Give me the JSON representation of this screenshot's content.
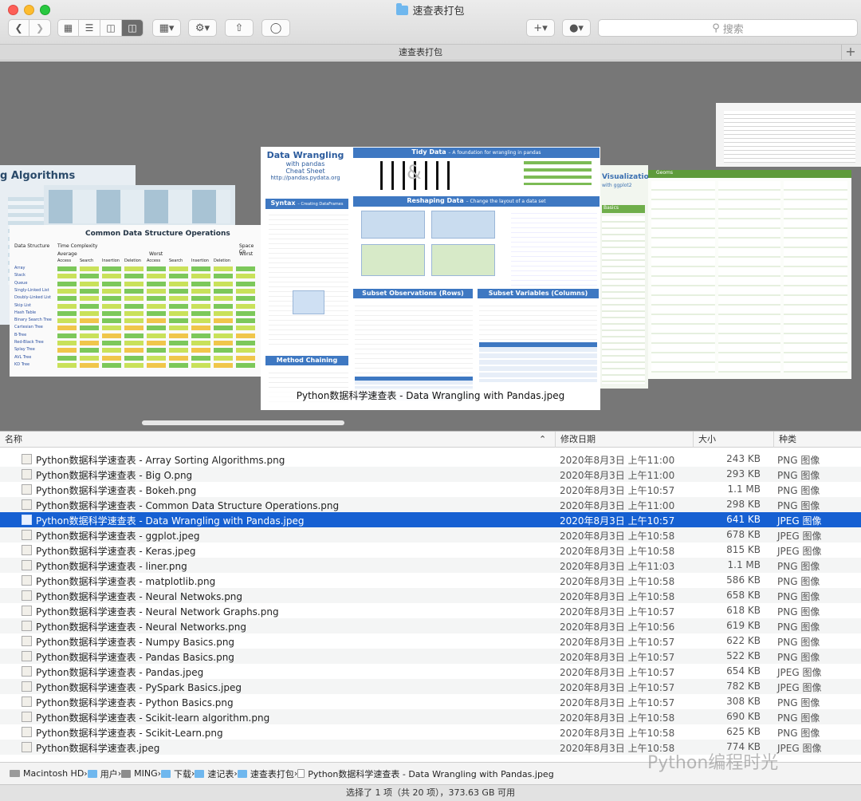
{
  "window": {
    "title": "速查表打包"
  },
  "toolbar": {
    "back_icon": "chevron-left-icon",
    "forward_icon": "chevron-right-icon",
    "search_placeholder": "搜索",
    "add_label": "+"
  },
  "tab": {
    "label": "速查表打包",
    "add_label": "+"
  },
  "coverflow": {
    "caption": "Python数据科学速查表 - Data Wrangling with Pandas.jpeg",
    "covers": {
      "left1_title": "g Algorithms",
      "left2_title": "Common Data Structure Operations",
      "left2_sub1": "Time Complexity",
      "left2_sub2": "Space Co",
      "left2_avg": "Average",
      "left2_worst": "Worst",
      "left2_worst2": "Worst",
      "left2_ds": "Data Structure",
      "left2_cols": [
        "Access",
        "Search",
        "Insertion",
        "Deletion",
        "Access",
        "Search",
        "Insertion",
        "Deletion"
      ],
      "left2_rows": [
        "Array",
        "Stack",
        "Queue",
        "Singly-Linked List",
        "Doubly-Linked List",
        "Skip List",
        "Hash Table",
        "Binary Search Tree",
        "Cartesian Tree",
        "B-Tree",
        "Red-Black Tree",
        "Splay Tree",
        "AVL Tree",
        "KD Tree"
      ],
      "main_t1": "Data Wrangling",
      "main_t2": "with pandas",
      "main_t3": "Cheat Sheet",
      "main_t4": "http://pandas.pydata.org",
      "main_tidy": "Tidy Data",
      "main_tidy_sub": "– A foundation for wrangling in pandas",
      "main_syntax": "Syntax",
      "main_syntax_sub": "– Creating DataFrames",
      "main_reshape": "Reshaping Data",
      "main_reshape_sub": "– Change the layout of a data set",
      "main_subset_obs": "Subset Observations (Rows)",
      "main_subset_vars": "Subset Variables (Columns)",
      "main_method": "Method Chaining",
      "right1_title": "Visualization",
      "right1_sub": "with ggplot2",
      "right1_basics": "Basics",
      "right1_geoms": "Geoms"
    }
  },
  "columns": {
    "name": "名称",
    "date": "修改日期",
    "size": "大小",
    "kind": "种类"
  },
  "files": [
    {
      "name": "Python数据科学速查表 - Array Sorting Algorithms.png",
      "date": "2020年8月3日 上午11:00",
      "size": "243 KB",
      "kind": "PNG 图像"
    },
    {
      "name": "Python数据科学速查表 - Big O.png",
      "date": "2020年8月3日 上午11:00",
      "size": "293 KB",
      "kind": "PNG 图像"
    },
    {
      "name": "Python数据科学速查表 - Bokeh.png",
      "date": "2020年8月3日 上午10:57",
      "size": "1.1 MB",
      "kind": "PNG 图像"
    },
    {
      "name": "Python数据科学速查表 - Common Data Structure Operations.png",
      "date": "2020年8月3日 上午11:00",
      "size": "298 KB",
      "kind": "PNG 图像"
    },
    {
      "name": "Python数据科学速查表 - Data Wrangling with Pandas.jpeg",
      "date": "2020年8月3日 上午10:57",
      "size": "641 KB",
      "kind": "JPEG 图像"
    },
    {
      "name": "Python数据科学速查表 - ggplot.jpeg",
      "date": "2020年8月3日 上午10:58",
      "size": "678 KB",
      "kind": "JPEG 图像"
    },
    {
      "name": "Python数据科学速查表 - Keras.jpeg",
      "date": "2020年8月3日 上午10:58",
      "size": "815 KB",
      "kind": "JPEG 图像"
    },
    {
      "name": "Python数据科学速查表 - liner.png",
      "date": "2020年8月3日 上午11:03",
      "size": "1.1 MB",
      "kind": "PNG 图像"
    },
    {
      "name": "Python数据科学速查表 - matplotlib.png",
      "date": "2020年8月3日 上午10:58",
      "size": "586 KB",
      "kind": "PNG 图像"
    },
    {
      "name": "Python数据科学速查表 - Neural Netwoks.png",
      "date": "2020年8月3日 上午10:58",
      "size": "658 KB",
      "kind": "PNG 图像"
    },
    {
      "name": "Python数据科学速查表 - Neural Network Graphs.png",
      "date": "2020年8月3日 上午10:57",
      "size": "618 KB",
      "kind": "PNG 图像"
    },
    {
      "name": "Python数据科学速查表 - Neural Networks.png",
      "date": "2020年8月3日 上午10:56",
      "size": "619 KB",
      "kind": "PNG 图像"
    },
    {
      "name": "Python数据科学速查表 - Numpy Basics.png",
      "date": "2020年8月3日 上午10:57",
      "size": "622 KB",
      "kind": "PNG 图像"
    },
    {
      "name": "Python数据科学速查表 - Pandas Basics.png",
      "date": "2020年8月3日 上午10:57",
      "size": "522 KB",
      "kind": "PNG 图像"
    },
    {
      "name": "Python数据科学速查表 - Pandas.jpeg",
      "date": "2020年8月3日 上午10:57",
      "size": "654 KB",
      "kind": "JPEG 图像"
    },
    {
      "name": "Python数据科学速查表 - PySpark Basics.jpeg",
      "date": "2020年8月3日 上午10:57",
      "size": "782 KB",
      "kind": "JPEG 图像"
    },
    {
      "name": "Python数据科学速查表 - Python Basics.png",
      "date": "2020年8月3日 上午10:57",
      "size": "308 KB",
      "kind": "PNG 图像"
    },
    {
      "name": "Python数据科学速查表 - Scikit-learn algorithm.png",
      "date": "2020年8月3日 上午10:58",
      "size": "690 KB",
      "kind": "PNG 图像"
    },
    {
      "name": "Python数据科学速查表 - Scikit-Learn.png",
      "date": "2020年8月3日 上午10:58",
      "size": "625 KB",
      "kind": "PNG 图像"
    },
    {
      "name": "Python数据科学速查表.jpeg",
      "date": "2020年8月3日 上午10:58",
      "size": "774 KB",
      "kind": "JPEG 图像"
    }
  ],
  "selected_index": 4,
  "pathbar": [
    "Macintosh HD",
    "用户",
    "MING",
    "下载",
    "速记表",
    "速查表打包",
    "Python数据科学速查表 - Data Wrangling with Pandas.jpeg"
  ],
  "status": "选择了 1 项（共 20 项），373.63 GB 可用",
  "watermark": "Python编程时光",
  "colors": {
    "selection": "#1660d2",
    "accent_blue": "#3e78c2"
  }
}
